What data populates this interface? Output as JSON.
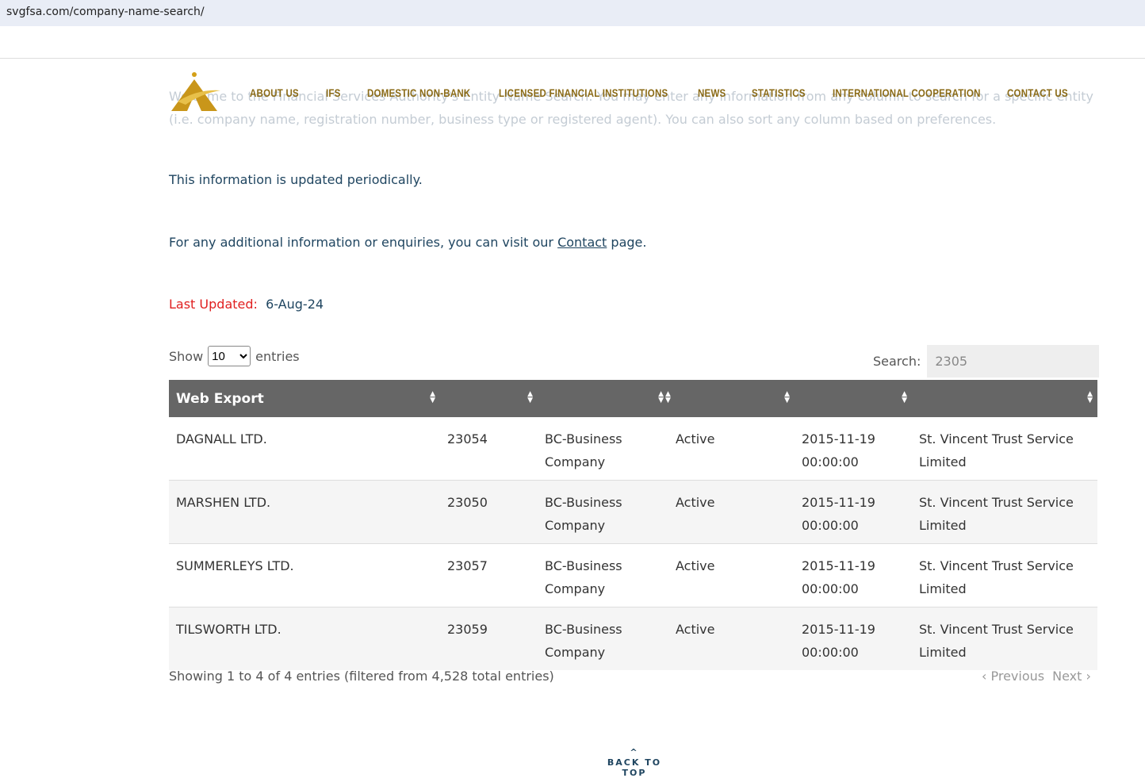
{
  "url": "svgfsa.com/company-name-search/",
  "nav": [
    "ABOUT US",
    "IFS",
    "DOMESTIC NON-BANK",
    "LICENSED FINANCIAL INSTITUTIONS",
    "NEWS",
    "STATISTICS",
    "INTERNATIONAL COOPERATION",
    "CONTACT US"
  ],
  "intro": "Welcome to the Financial Services Authority's Entity Name Search. You may enter any information from any column to search for a specific entity (i.e. company name, registration number, business type or registered agent). You can also sort any column based on preferences.",
  "updated_note": "This information is updated periodically.",
  "contact_pre": "For any additional information or enquiries, you can visit our ",
  "contact_link": "Contact",
  "contact_post": " page.",
  "last_updated_label": "Last Updated:",
  "last_updated_value": "6-Aug-24",
  "show_label": "Show",
  "show_value": "10",
  "entries_label": "entries",
  "search_label": "Search:",
  "search_value": "2305",
  "table": {
    "header": "Web Export",
    "rows": [
      [
        "DAGNALL LTD.",
        "23054",
        "BC-Business Company",
        "Active",
        "2015-11-19 00:00:00",
        "St. Vincent Trust Service Limited"
      ],
      [
        "MARSHEN LTD.",
        "23050",
        "BC-Business Company",
        "Active",
        "2015-11-19 00:00:00",
        "St. Vincent Trust Service Limited"
      ],
      [
        "SUMMERLEYS LTD.",
        "23057",
        "BC-Business Company",
        "Active",
        "2015-11-19 00:00:00",
        "St. Vincent Trust Service Limited"
      ],
      [
        "TILSWORTH LTD.",
        "23059",
        "BC-Business Company",
        "Active",
        "2015-11-19 00:00:00",
        "St. Vincent Trust Service Limited"
      ]
    ]
  },
  "info": "Showing 1 to 4 of 4 entries (filtered from 4,528 total entries)",
  "prev": "Previous",
  "next": "Next",
  "back_to_top": "BACK TO TOP"
}
